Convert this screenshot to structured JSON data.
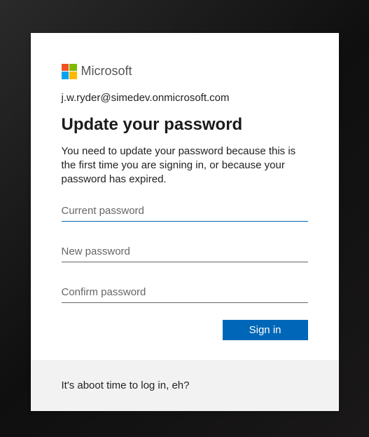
{
  "logo": {
    "text": "Microsoft"
  },
  "identity": "j.w.ryder@simedev.onmicrosoft.com",
  "title": "Update your password",
  "description": "You need to update your password because this is the first time you are signing in, or because your password has expired.",
  "fields": {
    "current": {
      "placeholder": "Current password"
    },
    "new": {
      "placeholder": "New password"
    },
    "confirm": {
      "placeholder": "Confirm password"
    }
  },
  "buttons": {
    "submit": "Sign in"
  },
  "footer": "It's aboot time to log in, eh?"
}
